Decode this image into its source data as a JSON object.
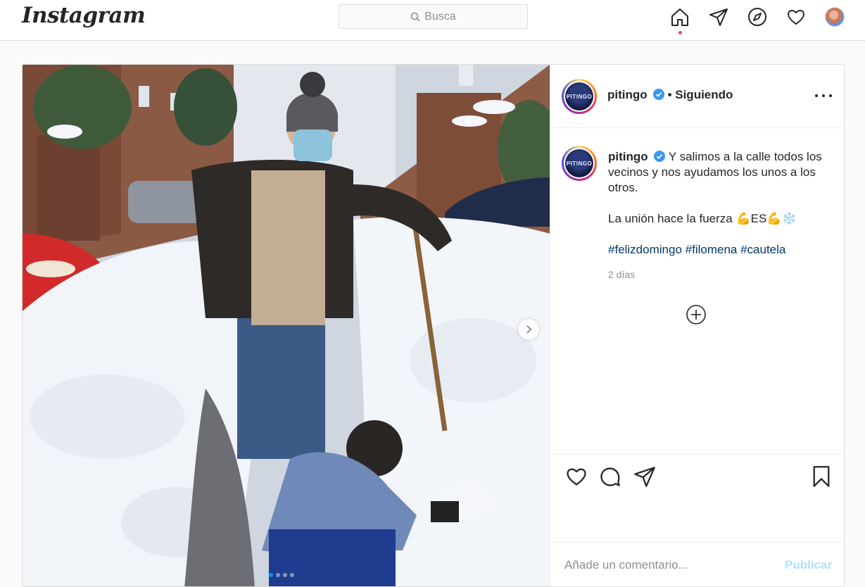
{
  "header": {
    "logo": "Instagram",
    "search_placeholder": "Busca"
  },
  "nav": {
    "icons": [
      "home-icon",
      "direct-icon",
      "explore-icon",
      "activity-icon",
      "profile-avatar"
    ],
    "accent": "#ed4956"
  },
  "post": {
    "username": "pitingo",
    "follow_status": "Siguiendo",
    "avatar_text": "PITINGO",
    "caption": {
      "username": "pitingo",
      "text": "Y salimos a la calle todos los vecinos y nos ayudamos los unos a los otros.",
      "line2": "La unión hace la fuerza",
      "emojis": "💪ES💪❄️",
      "hashtags": [
        "#felizdomingo",
        "#filomena",
        "#cautela"
      ]
    },
    "timestamp": "2 días",
    "carousel": {
      "count": 4,
      "active": 1
    },
    "comment_placeholder": "Añade un comentario...",
    "publish_label": "Publicar",
    "colors": {
      "verified": "#3897f0",
      "hashtag": "#00376b",
      "publish_disabled": "#b2dffc"
    }
  }
}
